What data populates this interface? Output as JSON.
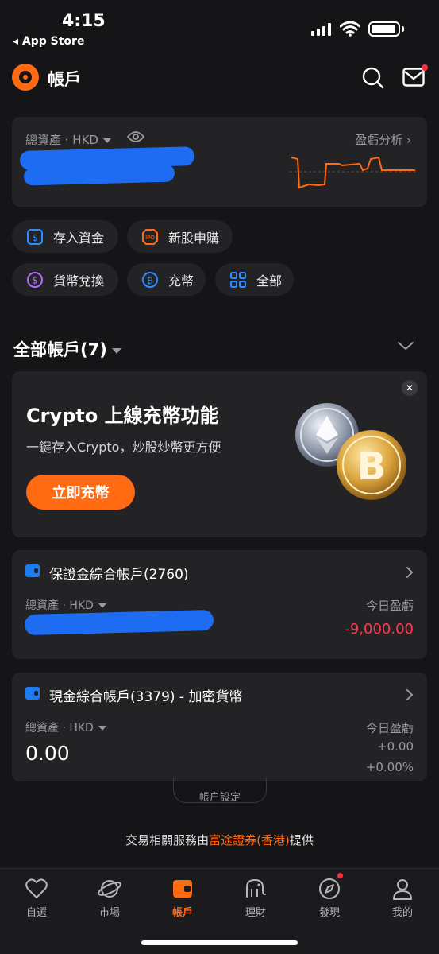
{
  "status_bar": {
    "time": "4:15",
    "back_label": "◂ App Store"
  },
  "header": {
    "title": "帳戶"
  },
  "assets": {
    "label": "總資產 · HKD",
    "pl_label": "盈虧分析"
  },
  "quick_actions": [
    {
      "label": "存入資金",
      "icon": "deposit-icon",
      "color": "#2f8cff"
    },
    {
      "label": "新股申購",
      "icon": "ipo-icon",
      "color": "#ff6a13"
    },
    {
      "label": "貨幣兌換",
      "icon": "currency-exchange-icon",
      "color": "#b06cff"
    },
    {
      "label": "充幣",
      "icon": "bitcoin-icon",
      "color": "#2f8cff"
    },
    {
      "label": "全部",
      "icon": "grid-icon",
      "color": "#2f8cff"
    }
  ],
  "accounts_section": {
    "title": "全部帳戶(7)"
  },
  "promo": {
    "title": "Crypto 上線充幣功能",
    "subtitle": "一鍵存入Crypto，炒股炒幣更方便",
    "button": "立即充幣",
    "close": "✕"
  },
  "accounts": [
    {
      "name": "保證金綜合帳戶(2760)",
      "asset_label": "總資產 · HKD",
      "pl_label": "今日盈虧",
      "pl_value": "-9,000.00"
    },
    {
      "name": "現金綜合帳戶(3379) - 加密貨幣",
      "asset_label": "總資產 · HKD",
      "asset_value": "0.00",
      "pl_label": "今日盈虧",
      "pl_value": "+0.00",
      "pl_percent": "+0.00%"
    }
  ],
  "settings_label": "帳户設定",
  "footer": {
    "prefix": "交易相關服務由",
    "provider": "富途證券(香港)",
    "suffix": "提供"
  },
  "tabs": [
    {
      "label": "自選",
      "icon": "heart-icon",
      "active": false
    },
    {
      "label": "市場",
      "icon": "planet-icon",
      "active": false
    },
    {
      "label": "帳戶",
      "icon": "wallet-icon",
      "active": true
    },
    {
      "label": "理財",
      "icon": "elephant-icon",
      "active": false
    },
    {
      "label": "發現",
      "icon": "compass-icon",
      "active": false
    },
    {
      "label": "我的",
      "icon": "user-icon",
      "active": false
    }
  ],
  "colors": {
    "accent": "#ff6a13",
    "loss": "#ff3b4c",
    "background": "#151517",
    "card": "#232326"
  }
}
